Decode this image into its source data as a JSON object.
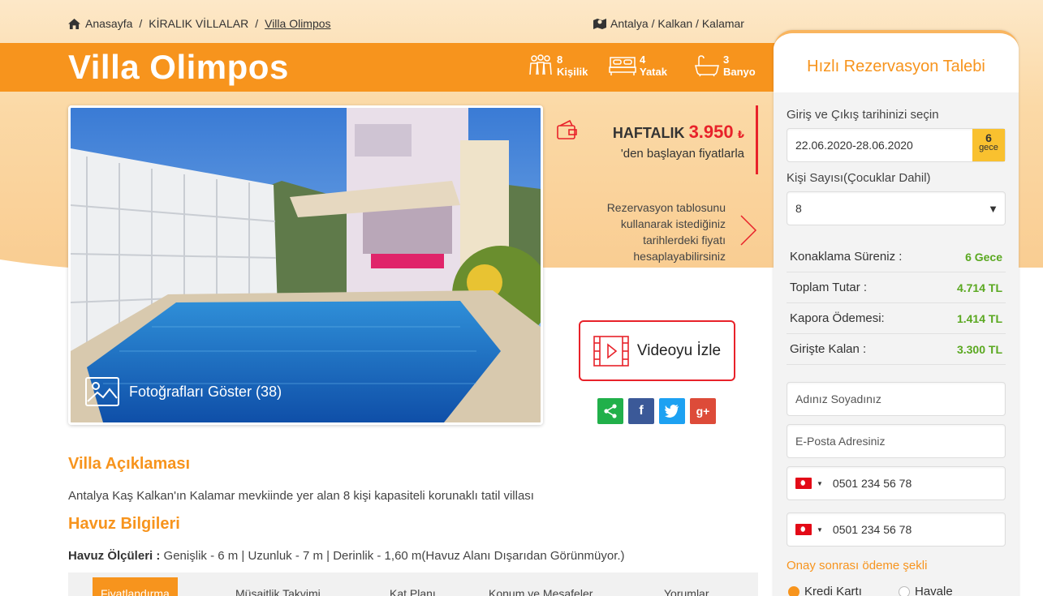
{
  "breadcrumb": {
    "home": "Anasayfa",
    "category": "KİRALIK VİLLALAR",
    "current": "Villa Olimpos"
  },
  "location": "Antalya / Kalkan / Kalamar",
  "villa": {
    "title": "Villa Olimpos",
    "features": [
      {
        "icon": "people-icon",
        "value": "8",
        "label": "Kişilik"
      },
      {
        "icon": "bed-icon",
        "value": "4",
        "label": "Yatak"
      },
      {
        "icon": "bathtub-icon",
        "value": "3",
        "label": "Banyo"
      }
    ],
    "photo_button": "Fotoğrafları Göster (38)"
  },
  "price": {
    "period": "HAFTALIK",
    "amount": "3.950",
    "currency": "₺",
    "sub": "'den başlayan fiyatlarla"
  },
  "calc_text": "Rezervasyon tablosunu kullanarak istediğiniz tarihlerdeki fiyatı hesaplayabilirsiniz",
  "video_button": "Videoyu İzle",
  "share": {
    "facebook": "f",
    "google": "g+"
  },
  "description": {
    "title": "Villa Açıklaması",
    "text": "Antalya Kaş Kalkan'ın Kalamar mevkiinde yer alan 8 kişi kapasiteli korunaklı tatil villası"
  },
  "pool": {
    "title": "Havuz Bilgileri",
    "label": "Havuz Ölçüleri :",
    "text": "Genişlik - 6 m | Uzunluk - 7 m | Derinlik - 1,60 m(Havuz Alanı Dışarıdan Görünmüyor.)"
  },
  "tabs": [
    "Fiyatlandırma",
    "Müsaitlik Takvimi",
    "Kat Planı",
    "Konum ve Mesafeler",
    "Yorumlar"
  ],
  "sidebar": {
    "title": "Hızlı Rezervasyon Talebi",
    "date_label": "Giriş ve Çıkış tarihinizi seçin",
    "date_value": "22.06.2020-28.06.2020",
    "nights_value": "6",
    "nights_label": "gece",
    "guests_label": "Kişi Sayısı(Çocuklar Dahil)",
    "guests_value": "8",
    "summary": [
      {
        "label": "Konaklama Süreniz :",
        "value": "6 Gece"
      },
      {
        "label": "Toplam Tutar :",
        "value": "4.714 TL"
      },
      {
        "label": "Kapora Ödemesi:",
        "value": "1.414 TL"
      },
      {
        "label": "Girişte Kalan :",
        "value": "3.300 TL"
      }
    ],
    "name_placeholder": "Adınız Soyadınız",
    "email_placeholder": "E-Posta Adresiniz",
    "phone1": "0501 234 56 78",
    "phone2": "0501 234 56 78",
    "payment_title": "Onay sonrası ödeme şekli",
    "payment_options": [
      "Kredi Kartı",
      "Havale"
    ],
    "payment_selected": "Kredi Kartı"
  },
  "colors": {
    "accent": "#f7941d",
    "price_red": "#e8222a",
    "summary_green": "#5aa820"
  }
}
